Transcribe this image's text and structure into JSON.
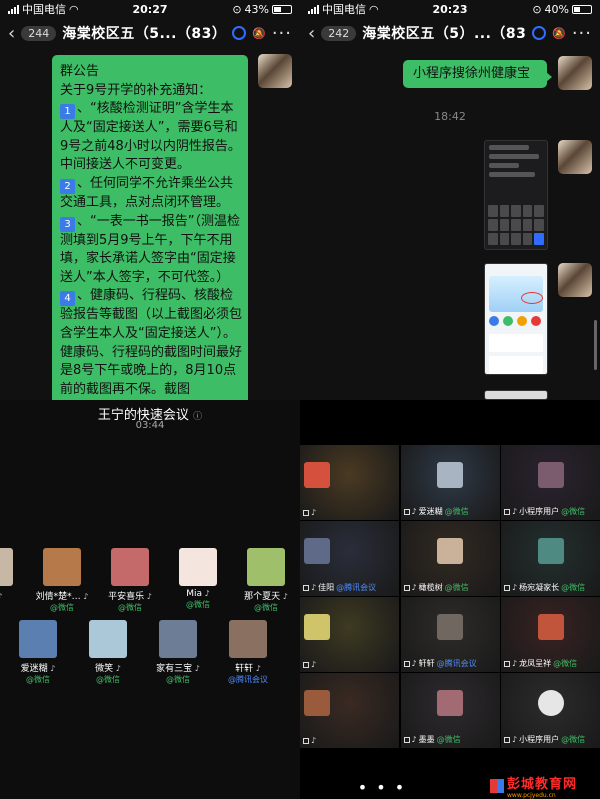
{
  "left_chat": {
    "status": {
      "carrier": "中国电信",
      "time": "20:27",
      "battery": "43%",
      "battery_level": 0.43
    },
    "nav": {
      "unread": "244",
      "title": "海棠校区五（5...（83）"
    },
    "notice": {
      "heading": "群公告",
      "intro": "关于9号开学的补充通知：",
      "items": [
        {
          "num": "1",
          "text": "、“核酸检测证明”含学生本人及“固定接送人”，需要6号和9号之前48小时以内阴性报告。中间接送人不可变更。"
        },
        {
          "num": "2",
          "text": "、任何同学不允许乘坐公共交通工具，点对点闭环管理。"
        },
        {
          "num": "3",
          "text": "、“一表一书一报告”（测温检测填到5月9号上午，下午不用填，家长承诺人签字由“固定接送人”本人签字，不可代签。）"
        },
        {
          "num": "4",
          "text": "、健康码、行程码、核酸检验报告等截图（以上截图必须包含学生本人及“固定接送人”）。健康码、行程码的截图时间最好是8号下午或晚上的，8月10点前的截图再不保。截图"
        }
      ]
    }
  },
  "right_chat": {
    "status": {
      "carrier": "中国电信",
      "time": "20:23",
      "battery": "40%",
      "battery_level": 0.4
    },
    "nav": {
      "unread": "242",
      "title": "海棠校区五（5）...（83）"
    },
    "message": "小程序搜徐州健康宝",
    "timestamp": "18:42"
  },
  "meeting": {
    "title": "王宁的快速会议",
    "duration": "03:44",
    "participants_row1": [
      {
        "name": "宁",
        "source": "",
        "color": "#c7b7a5"
      },
      {
        "name": "刘倩*楚*…",
        "source": "@微信",
        "color": "#b67a4a"
      },
      {
        "name": "平安喜乐",
        "source": "@微信",
        "color": "#c46a6a"
      },
      {
        "name": "Mia",
        "source": "@微信",
        "color": "#f4e6de"
      },
      {
        "name": "那个夏天",
        "source": "@微信",
        "color": "#9fbf6a"
      }
    ],
    "participants_row2": [
      {
        "name": "爱迷糊",
        "source": "@微信",
        "color": "#5b7fb0"
      },
      {
        "name": "微笑",
        "source": "@微信",
        "color": "#aac8d8"
      },
      {
        "name": "家有三宝",
        "source": "@微信",
        "color": "#6e7d96"
      },
      {
        "name": "轩轩",
        "source": "@腾讯会议",
        "color": "#8a7060"
      }
    ]
  },
  "video_grid": [
    {
      "name": "",
      "source": "",
      "bg": "#4a3a22",
      "av": "#d5513d"
    },
    {
      "name": "爱迷糊",
      "source": "@微信",
      "bg": "#2f3a48",
      "av": "#a8b4c2"
    },
    {
      "name": "小程序用户",
      "source": "@微信",
      "bg": "#2b2330",
      "av": "#7a5c6e"
    },
    {
      "name": "佳阳",
      "source": "@腾讯会议",
      "bg": "#2a2e3a",
      "av": "#5f6a88"
    },
    {
      "name": "橄榄树",
      "source": "@微信",
      "bg": "#332a22",
      "av": "#c9b19a"
    },
    {
      "name": "杨宛凝家长",
      "source": "@微信",
      "bg": "#23302f",
      "av": "#4e8a82"
    },
    {
      "name": "",
      "source": "",
      "bg": "#3e3a22",
      "av": "#d0c46a"
    },
    {
      "name": "轩轩",
      "source": "@腾讯会议",
      "bg": "#2e2c2a",
      "av": "#6f6760"
    },
    {
      "name": "龙凤呈祥",
      "source": "@微信",
      "bg": "#3a2222",
      "av": "#c1553c"
    },
    {
      "name": "",
      "source": "",
      "bg": "#3a2a22",
      "av": "#9a5a3c"
    },
    {
      "name": "墨墨",
      "source": "@微信",
      "bg": "#2e2a2e",
      "av": "#a26a72"
    },
    {
      "name": "小程序用户",
      "source": "@微信",
      "bg": "#2c2c2c",
      "av": "#e6e6e6"
    }
  ],
  "watermark": {
    "name": "彭城教育网",
    "url": "www.pcjyedu.cn"
  },
  "icons": [
    "back-icon",
    "group-app-icon",
    "mute-icon",
    "more-icon",
    "microphone-icon",
    "info-icon"
  ]
}
